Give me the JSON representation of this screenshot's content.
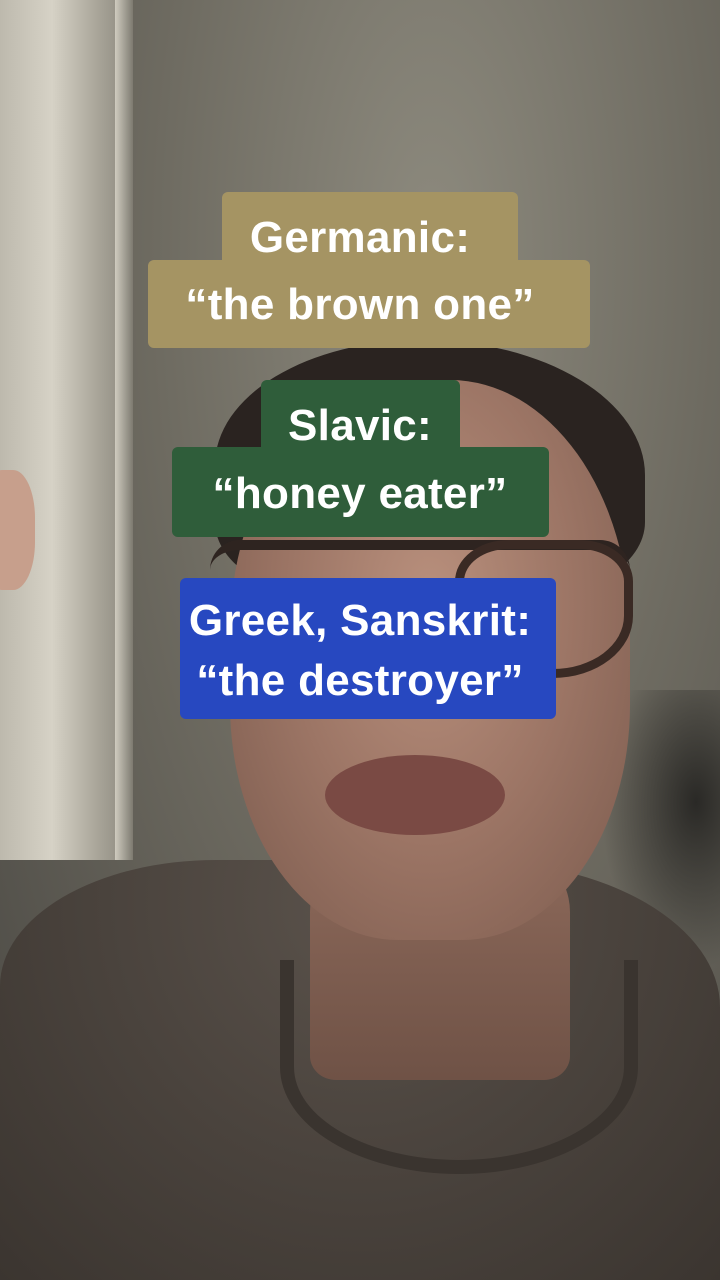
{
  "captions": [
    {
      "line1": "Germanic:",
      "line2": "“the brown one”",
      "color": "#a59463"
    },
    {
      "line1": "Slavic:",
      "line2": "“honey eater”",
      "color": "#2f5d3a"
    },
    {
      "line1": "Greek, Sanskrit:",
      "line2": "“the destroyer”",
      "color": "#2748c0"
    }
  ]
}
